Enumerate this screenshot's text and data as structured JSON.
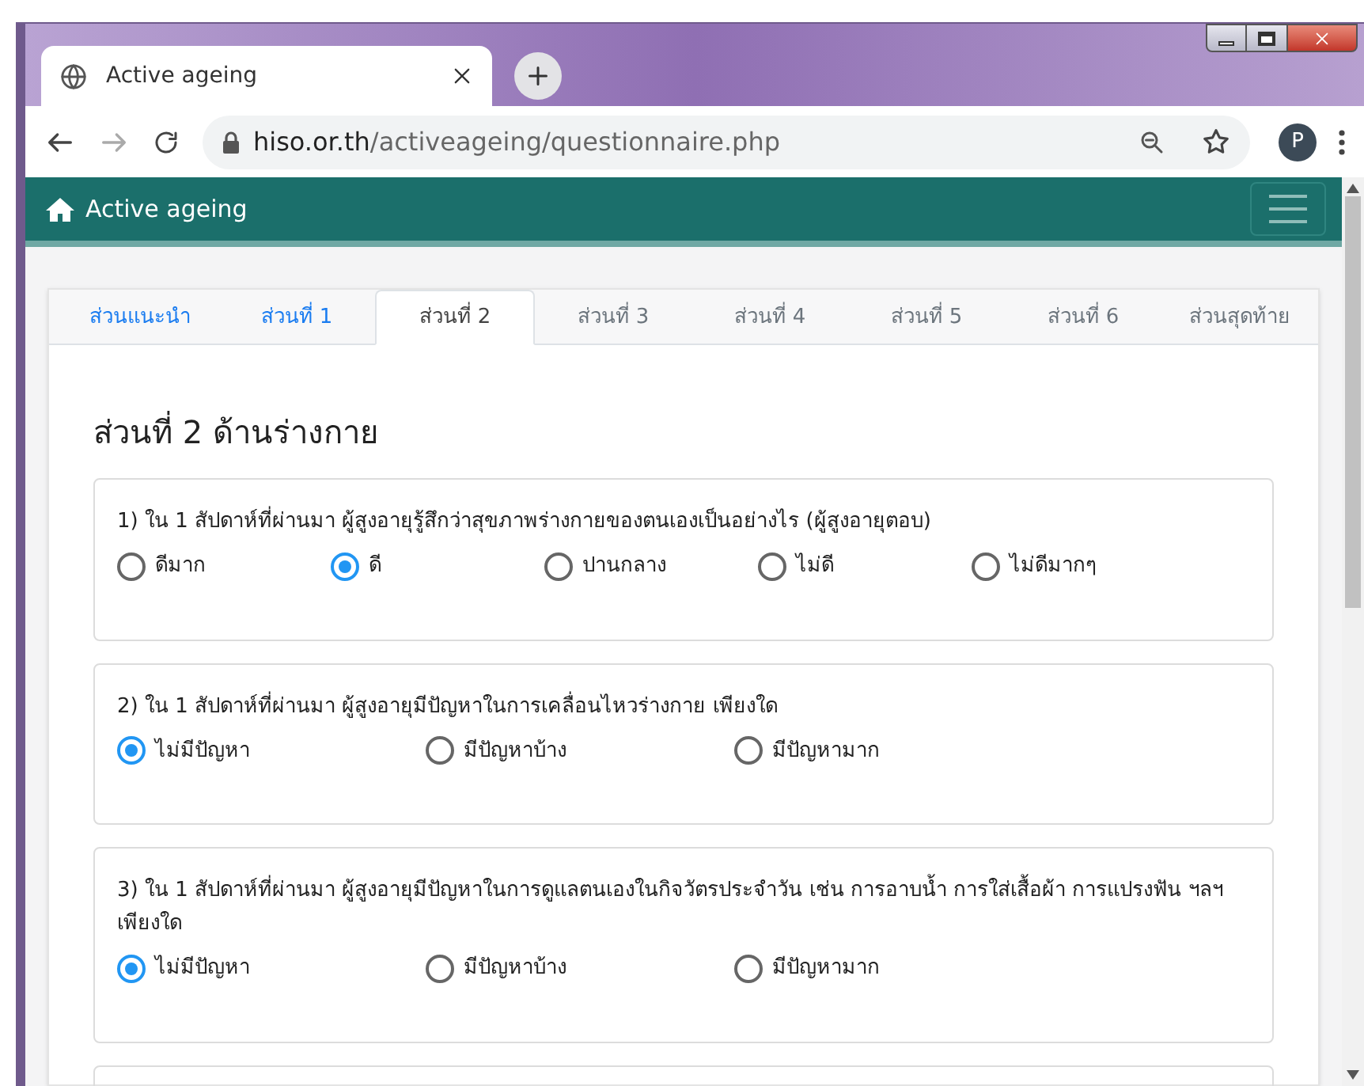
{
  "browser": {
    "tab_title": "Active ageing",
    "url_host": "hiso.or.th",
    "url_path": "/activeageing/questionnaire.php",
    "profile_initial": "P"
  },
  "navbar": {
    "brand": "Active ageing"
  },
  "section_tabs": [
    {
      "label": "ส่วนแนะนำ",
      "selected": false,
      "disabled": false
    },
    {
      "label": "ส่วนที่ 1",
      "selected": false,
      "disabled": false
    },
    {
      "label": "ส่วนที่ 2",
      "selected": true,
      "disabled": false
    },
    {
      "label": "ส่วนที่ 3",
      "selected": false,
      "disabled": true
    },
    {
      "label": "ส่วนที่ 4",
      "selected": false,
      "disabled": true
    },
    {
      "label": "ส่วนที่ 5",
      "selected": false,
      "disabled": true
    },
    {
      "label": "ส่วนที่ 6",
      "selected": false,
      "disabled": true
    },
    {
      "label": "ส่วนสุดท้าย",
      "selected": false,
      "disabled": true
    }
  ],
  "section_title": "ส่วนที่ 2 ด้านร่างกาย",
  "questions": [
    {
      "text": "1) ใน 1 สัปดาห์ที่ผ่านมา ผู้สูงอายุรู้สึกว่าสุขภาพร่างกายของตนเองเป็นอย่างไร (ผู้สูงอายุตอบ)",
      "options": [
        {
          "label": "ดีมาก",
          "selected": false
        },
        {
          "label": "ดี",
          "selected": true
        },
        {
          "label": "ปานกลาง",
          "selected": false
        },
        {
          "label": "ไม่ดี",
          "selected": false
        },
        {
          "label": "ไม่ดีมากๆ",
          "selected": false
        }
      ]
    },
    {
      "text": "2) ใน 1 สัปดาห์ที่ผ่านมา ผู้สูงอายุมีปัญหาในการเคลื่อนไหวร่างกาย เพียงใด",
      "options": [
        {
          "label": "ไม่มีปัญหา",
          "selected": true
        },
        {
          "label": "มีปัญหาบ้าง",
          "selected": false
        },
        {
          "label": "มีปัญหามาก",
          "selected": false
        }
      ]
    },
    {
      "text": "3) ใน 1 สัปดาห์ที่ผ่านมา ผู้สูงอายุมีปัญหาในการดูแลตนเองในกิจวัตรประจำวัน เช่น การอาบน้ำ การใส่เสื้อผ้า การแปรงฟัน ฯลฯ เพียงใด",
      "options": [
        {
          "label": "ไม่มีปัญหา",
          "selected": true
        },
        {
          "label": "มีปัญหาบ้าง",
          "selected": false
        },
        {
          "label": "มีปัญหามาก",
          "selected": false
        }
      ]
    }
  ]
}
